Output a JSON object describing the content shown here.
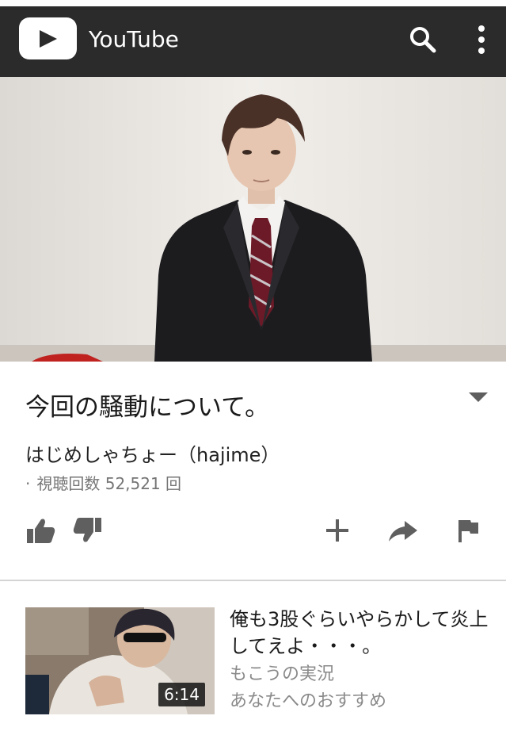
{
  "app": {
    "title": "YouTube",
    "logo_icon": "play-logo-icon",
    "search_icon": "search-icon",
    "menu_icon": "more-vert-icon",
    "bar_color": "#2b2b2b"
  },
  "video": {
    "title": "今回の騒動について。",
    "channel": "はじめしゃちょー（hajime）",
    "views_dot": "·",
    "views": "視聴回数 52,521 回"
  },
  "actions": [
    {
      "name": "like",
      "icon": "thumb-up-icon"
    },
    {
      "name": "dislike",
      "icon": "thumb-down-icon"
    },
    {
      "name": "add-to-playlist",
      "icon": "plus-icon"
    },
    {
      "name": "share",
      "icon": "share-icon"
    },
    {
      "name": "report",
      "icon": "flag-icon"
    }
  ],
  "recommendation": {
    "title": "俺も3股ぐらいやらかして炎上してえよ・・・。",
    "channel": "もこうの実況",
    "reason": "あなたへのおすすめ",
    "duration": "6:14"
  }
}
